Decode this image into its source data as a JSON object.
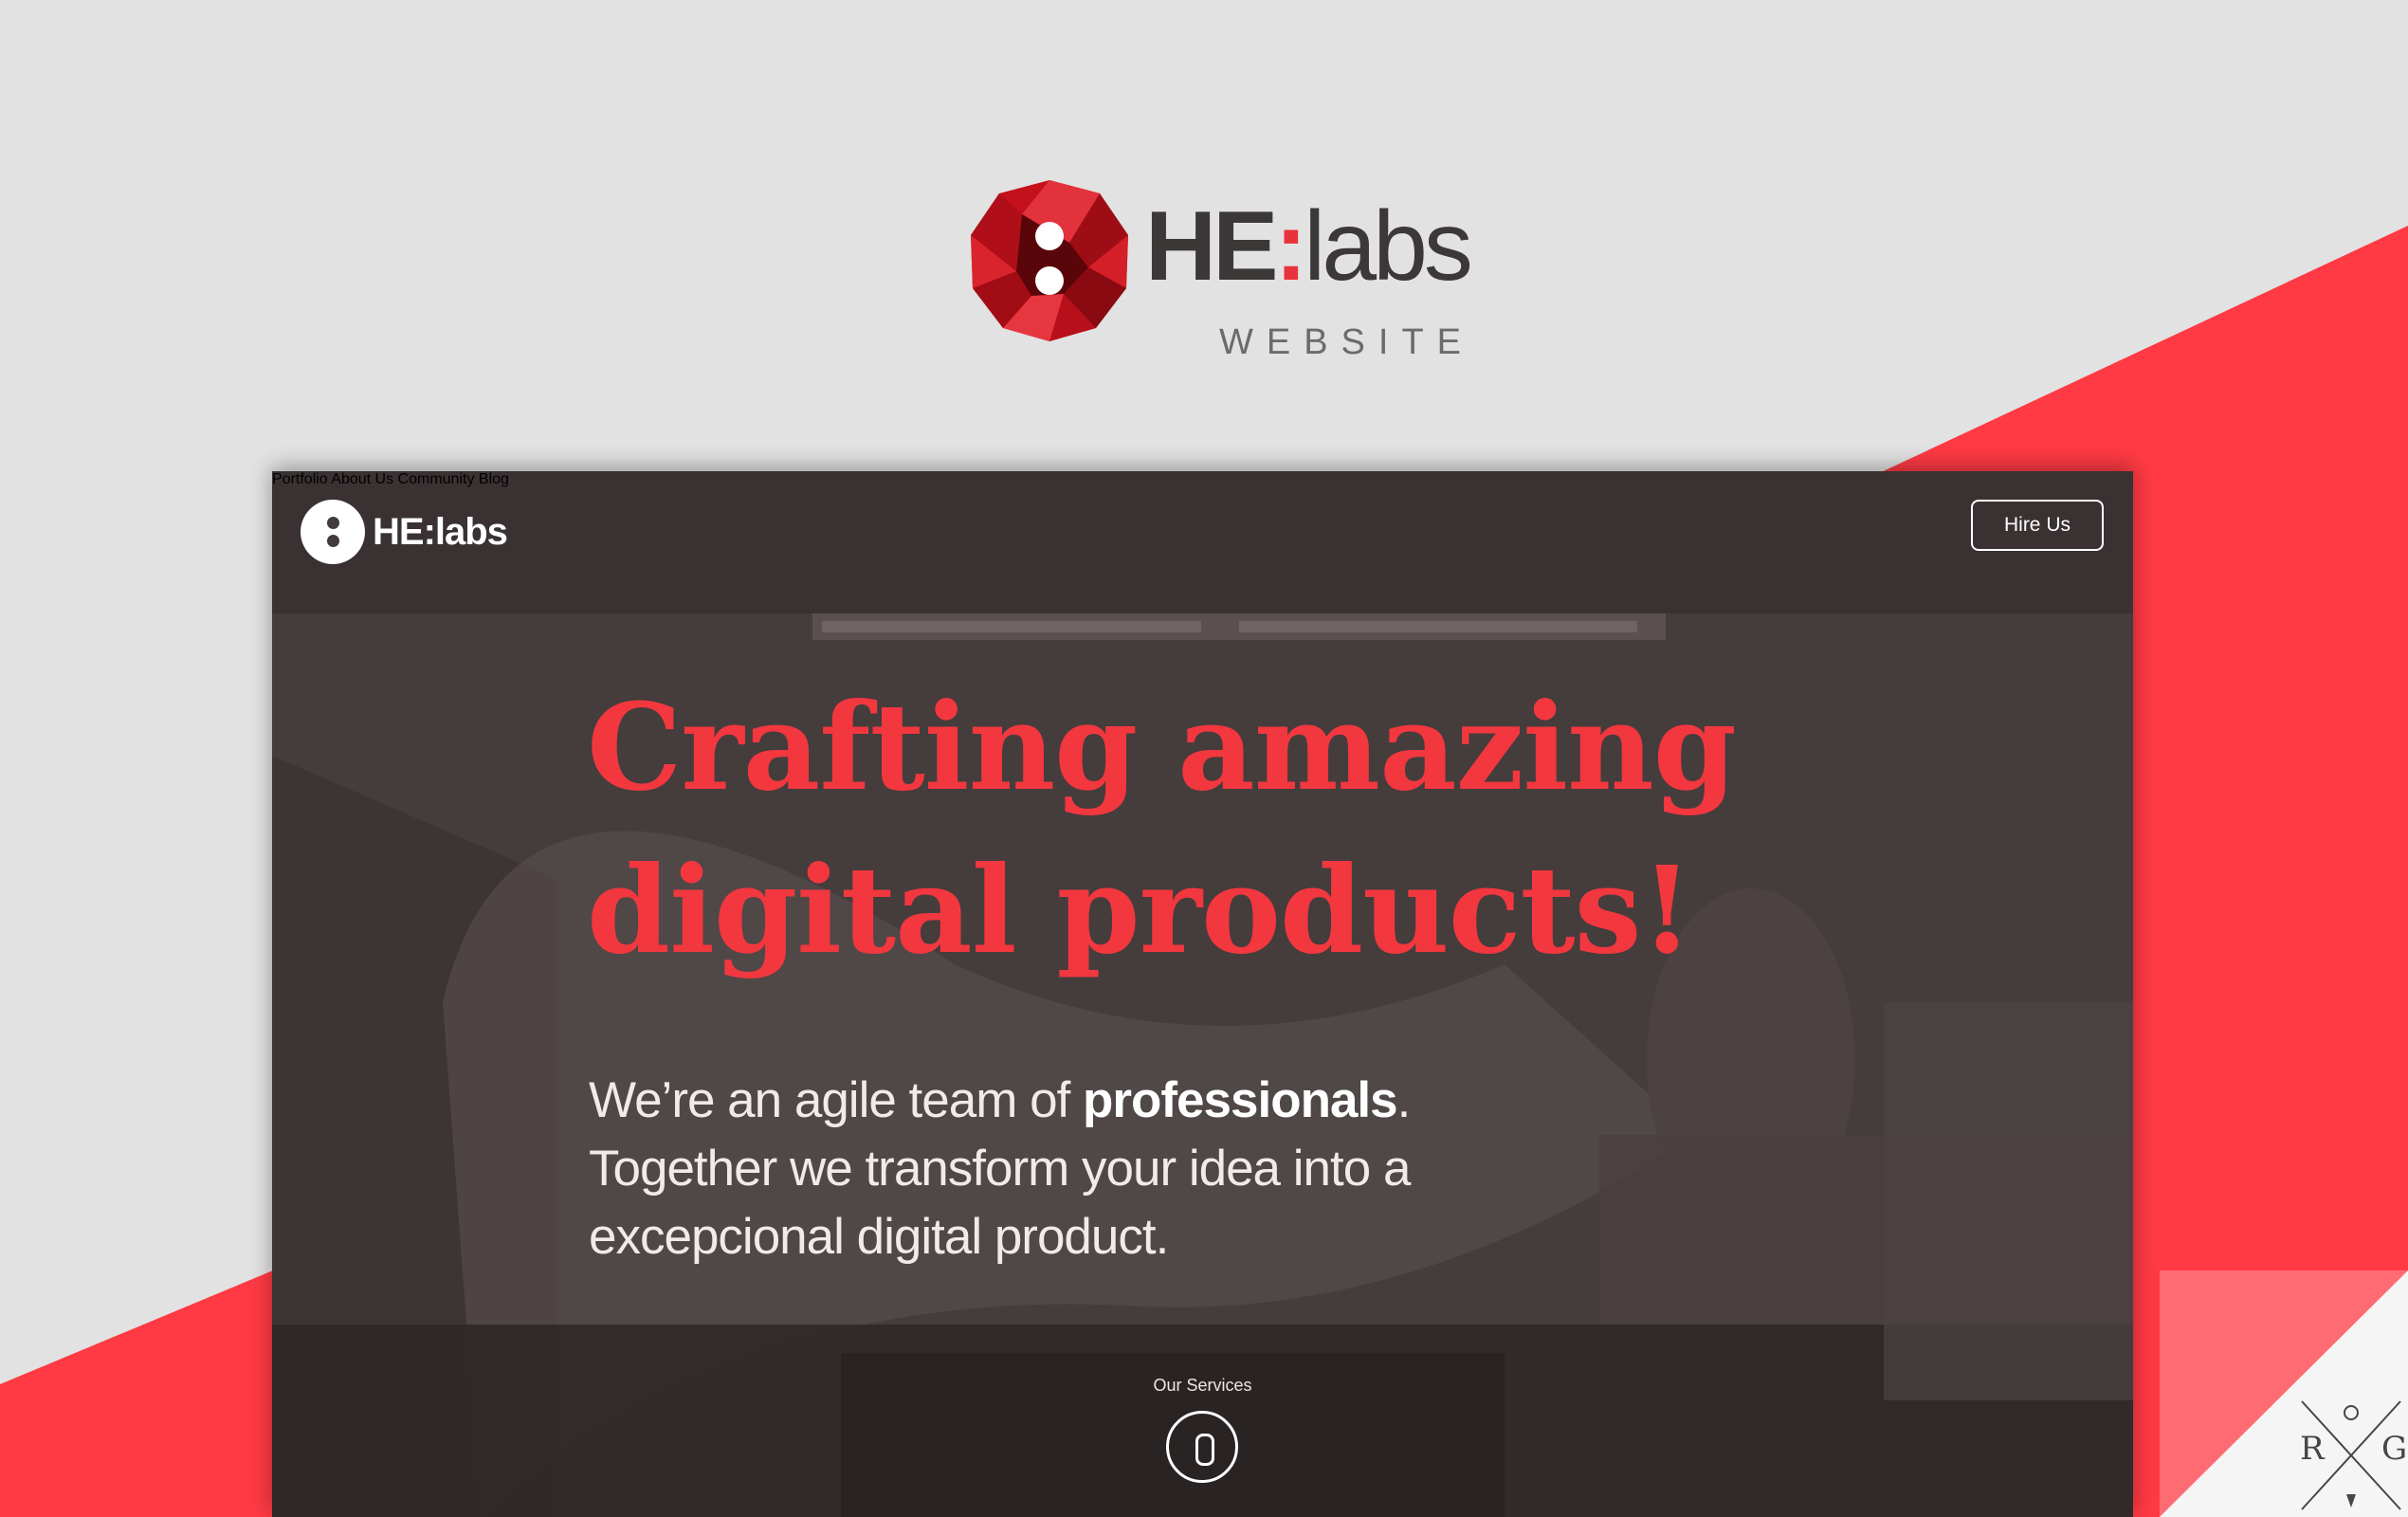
{
  "colors": {
    "accent": "#e8323c",
    "background": "#e2e2e2",
    "site_background": "#433b3b"
  },
  "presentation": {
    "brand_prefix": "HE",
    "brand_colon": ":",
    "brand_suffix": "labs",
    "subtitle": "WEBSITE"
  },
  "site": {
    "logo_text": "HE:labs",
    "nav": {
      "portfolio": "Portfolio",
      "about": "About Us",
      "community": "Community",
      "blog": "Blog",
      "hire": "Hire Us"
    },
    "hero": {
      "headline_line1": "Crafting amazing",
      "headline_line2": "digital products!",
      "intro_line1_start": "We’re an agile team of ",
      "intro_line1_bold": "professionals",
      "intro_line1_end": ".",
      "intro_line2": "Together we transform your idea into a",
      "intro_line3": "excepcional digital product."
    },
    "services_label": "Our Services"
  },
  "corner_mark": {
    "left": "R",
    "right": "G"
  }
}
